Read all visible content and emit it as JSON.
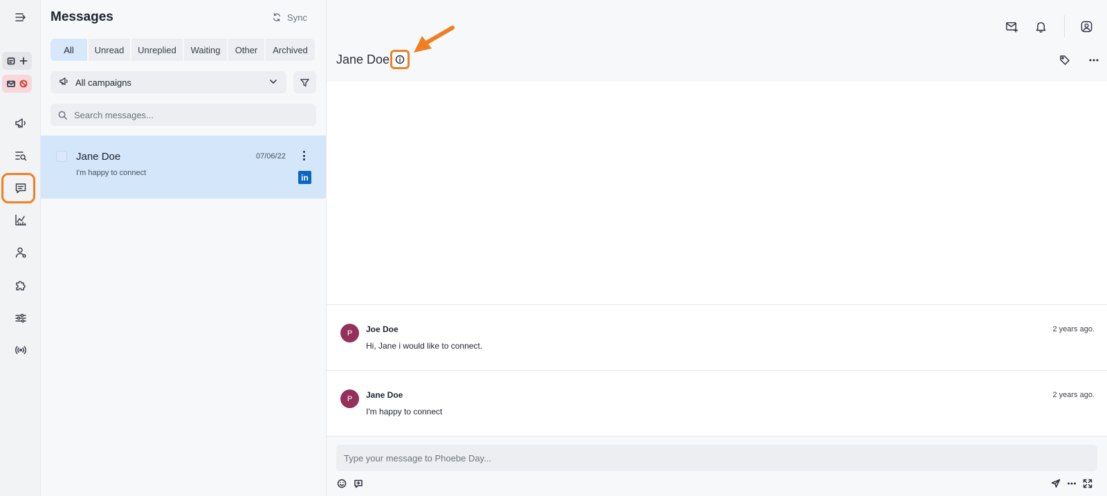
{
  "rail": {
    "icons": [
      "menu-collapse-icon",
      "calendar-add-icon",
      "mail-block-icon",
      "megaphone-icon",
      "search-list-icon",
      "chat-icon",
      "chart-icon",
      "user-settings-icon",
      "puzzle-icon",
      "sliders-icon",
      "broadcast-icon"
    ],
    "accent": "#f07f22"
  },
  "panel": {
    "title": "Messages",
    "sync_label": "Sync",
    "tabs": [
      {
        "label": "All",
        "active": true
      },
      {
        "label": "Unread",
        "active": false
      },
      {
        "label": "Unreplied",
        "active": false
      },
      {
        "label": "Waiting",
        "active": false
      },
      {
        "label": "Other",
        "active": false
      },
      {
        "label": "Archived",
        "active": false
      }
    ],
    "campaign_select": "All campaigns",
    "search_placeholder": "Search messages...",
    "conversations": [
      {
        "name": "Jane Doe",
        "snippet": "I'm happy to connect",
        "date": "07/06/22",
        "source_icon": "linkedin-icon",
        "source_glyph": "in",
        "selected": true
      }
    ]
  },
  "main": {
    "contact_name": "Jane Doe",
    "messages": [
      {
        "avatar": "P",
        "sender": "Joe Doe",
        "text": "Hi, Jane i would like to connect.",
        "time": "2 years ago."
      },
      {
        "avatar": "P",
        "sender": "Jane Doe",
        "text": "I'm happy to connect",
        "time": "2 years ago."
      }
    ],
    "composer_placeholder": "Type your message to Phoebe Day..."
  },
  "colors": {
    "selected_row": "#d3e6fa",
    "active_tab": "#d7e8fb",
    "avatar": "#94315a",
    "linkedin": "#0a66c2",
    "highlight": "#f07f22"
  }
}
